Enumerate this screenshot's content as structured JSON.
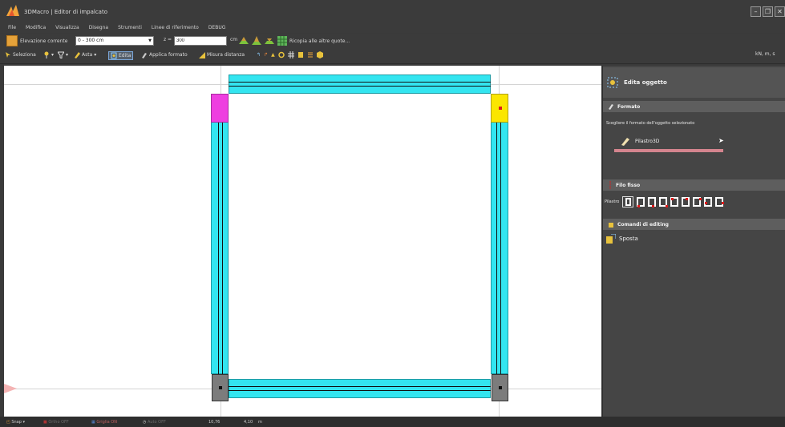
{
  "window": {
    "title": "3DMacro | Editor di impalcato"
  },
  "menu": [
    "File",
    "Modifica",
    "Visualizza",
    "Disegna",
    "Strumenti",
    "Linee di riferimento",
    "DEBUG"
  ],
  "toolbar1": {
    "elevation_label": "Elevazione corrente",
    "elevation_value": "0 - 300 cm",
    "z_label": "z =",
    "z_value": "300",
    "unit": "cm",
    "recalc_label": "Ricopia alle altre quote..."
  },
  "toolbar2": {
    "select_label": "Seleziona",
    "beam_label": "Asta",
    "edit_label": "Edita",
    "apply_format_label": "Applica formato",
    "measure_label": "Misura distanza",
    "units_label": "kN, m, s"
  },
  "side_panel": {
    "edit_title": "Edita oggetto",
    "format_header": "Formato",
    "format_hint": "Scegliere il formato dell'oggetto selezionato",
    "format_item": "Pilastro3D",
    "wire_header": "Filo fisso",
    "wire_label": "Pilastro",
    "editing_header": "Comandi di editing",
    "move_label": "Sposta"
  },
  "statusbar": {
    "snap": "Snap",
    "ortho": "Ortho OFF",
    "grid": "Griglia ON",
    "auto": "Auto OFF",
    "coord_x": "10,76",
    "coord_y": "4,10",
    "coord_unit": "m"
  },
  "colors": {
    "beam": "#33e5f0",
    "selected_column": "#ee3fe0",
    "highlight_column": "#fbe600",
    "plain_column": "#7c7c7c",
    "accent_red": "#dd1a1a"
  }
}
